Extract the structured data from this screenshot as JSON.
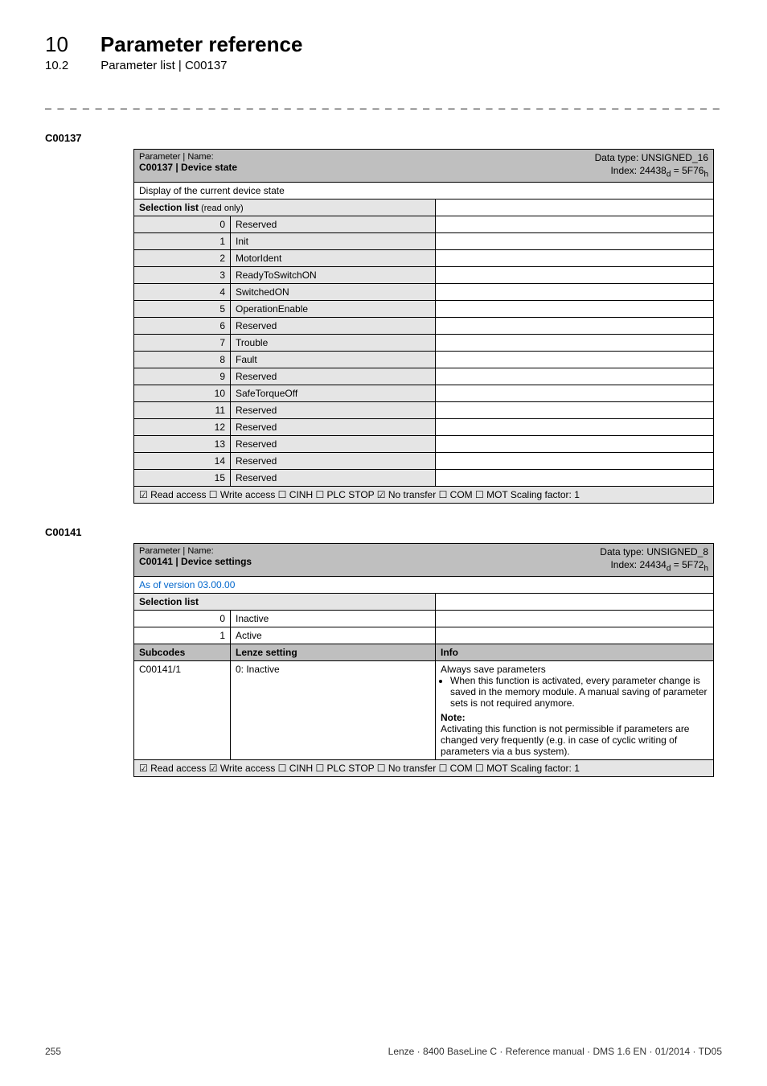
{
  "header": {
    "chapter_num": "10",
    "chapter_title": "Parameter reference",
    "section_num": "10.2",
    "section_title": "Parameter list | C00137"
  },
  "dashline": "_ _ _ _ _ _ _ _ _ _ _ _ _ _ _ _ _ _ _ _ _ _ _ _ _ _ _ _ _ _ _ _ _ _ _ _ _ _ _ _ _ _ _ _ _ _ _ _ _ _ _ _ _ _ _ _ _ _ _ _ _ _ _ _",
  "t1": {
    "code": "C00137",
    "pn_label": "Parameter | Name:",
    "pn_name": "C00137 | Device state",
    "dtype_line1": "Data type: UNSIGNED_16",
    "dtype_line2": "Index: 24438",
    "dtype_sub": "d",
    "dtype_eq": " = 5F76",
    "dtype_sub2": "h",
    "display": "Display of the current device state",
    "sel_label": "Selection list",
    "sel_sub": " (read only)",
    "rows": [
      {
        "n": "0",
        "v": "Reserved"
      },
      {
        "n": "1",
        "v": "Init"
      },
      {
        "n": "2",
        "v": "MotorIdent"
      },
      {
        "n": "3",
        "v": "ReadyToSwitchON"
      },
      {
        "n": "4",
        "v": "SwitchedON"
      },
      {
        "n": "5",
        "v": "OperationEnable"
      },
      {
        "n": "6",
        "v": "Reserved"
      },
      {
        "n": "7",
        "v": "Trouble"
      },
      {
        "n": "8",
        "v": "Fault"
      },
      {
        "n": "9",
        "v": "Reserved"
      },
      {
        "n": "10",
        "v": "SafeTorqueOff"
      },
      {
        "n": "11",
        "v": "Reserved"
      },
      {
        "n": "12",
        "v": "Reserved"
      },
      {
        "n": "13",
        "v": "Reserved"
      },
      {
        "n": "14",
        "v": "Reserved"
      },
      {
        "n": "15",
        "v": "Reserved"
      }
    ],
    "footer": "☑ Read access   ☐ Write access   ☐ CINH   ☐ PLC STOP   ☑ No transfer   ☐ COM   ☐ MOT      Scaling factor: 1"
  },
  "t2": {
    "code": "C00141",
    "pn_label": "Parameter | Name:",
    "pn_name": "C00141 | Device settings",
    "dtype_line1": "Data type: UNSIGNED_8",
    "dtype_line2": "Index: 24434",
    "dtype_sub": "d",
    "dtype_eq": " = 5F72",
    "dtype_sub2": "h",
    "version_link": "As of version 03.00.00",
    "sel_label": "Selection list",
    "rows": [
      {
        "n": "0",
        "v": "Inactive"
      },
      {
        "n": "1",
        "v": "Active"
      }
    ],
    "col_sub": "Subcodes",
    "col_lenze": "Lenze setting",
    "col_info": "Info",
    "sub_code": "C00141/1",
    "sub_lenze": "0: Inactive",
    "info_lead": "Always save parameters",
    "info_bullet": "When this function is activated, every parameter change is saved in the memory module. A manual saving of parameter sets is not required anymore.",
    "info_note_label": "Note:",
    "info_note_body": "Activating this function is not permissible if parameters are changed very frequently (e.g. in case of cyclic writing of parameters via a bus system).",
    "footer": "☑ Read access   ☑ Write access   ☐ CINH   ☐ PLC STOP   ☐ No transfer   ☐ COM   ☐ MOT      Scaling factor: 1"
  },
  "footer": {
    "page": "255",
    "right": "Lenze · 8400 BaseLine C · Reference manual · DMS 1.6 EN · 01/2014 · TD05"
  }
}
